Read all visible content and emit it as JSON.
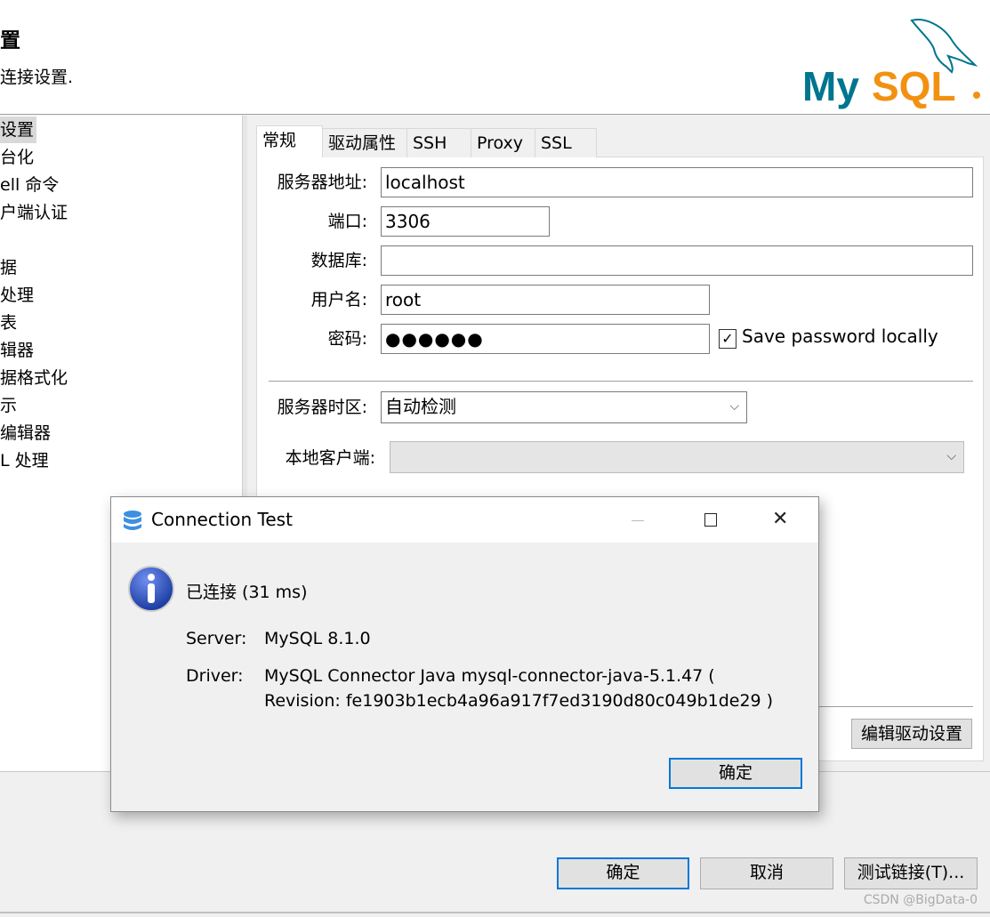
{
  "header": {
    "title": "置",
    "subtitle": "连接设置.",
    "logo_text": "MySQL"
  },
  "left_nav": [
    "设置",
    "台化",
    "ell 命令",
    "户端认证",
    "",
    "据",
    "处理",
    "表",
    "辑器",
    "据格式化",
    "示",
    "编辑器",
    "L 处理"
  ],
  "tabs": [
    "常规",
    "驱动属性",
    "SSH",
    "Proxy",
    "SSL"
  ],
  "form": {
    "host_label": "服务器地址:",
    "host": "localhost",
    "port_label": "端口:",
    "port": "3306",
    "db_label": "数据库:",
    "db": "",
    "user_label": "用户名:",
    "user": "root",
    "pwd_label": "密码:",
    "pwd": "●●●●●●",
    "save_pwd": "Save password locally",
    "save_pwd_checked": true,
    "tz_label": "服务器时区:",
    "tz": "自动检测",
    "client_label": "本地客户端:",
    "client": ""
  },
  "edit_driver": "编辑驱动设置",
  "buttons": {
    "ok": "确定",
    "cancel": "取消",
    "test": "测试链接(T)..."
  },
  "dialog": {
    "title": "Connection Test",
    "status": "已连接 (31 ms)",
    "server_label": "Server:",
    "server": "MySQL 8.1.0",
    "driver_label": "Driver:",
    "driver_line1": "MySQL Connector Java mysql-connector-java-5.1.47 (",
    "driver_line2": "Revision: fe1903b1ecb4a96a917f7ed3190d80c049b1de29 )",
    "ok": "确定"
  },
  "watermark": "CSDN @BigData-0",
  "colors": {
    "accent": "#0078d7",
    "mysql_teal": "#00758f",
    "mysql_orange": "#f29111"
  }
}
